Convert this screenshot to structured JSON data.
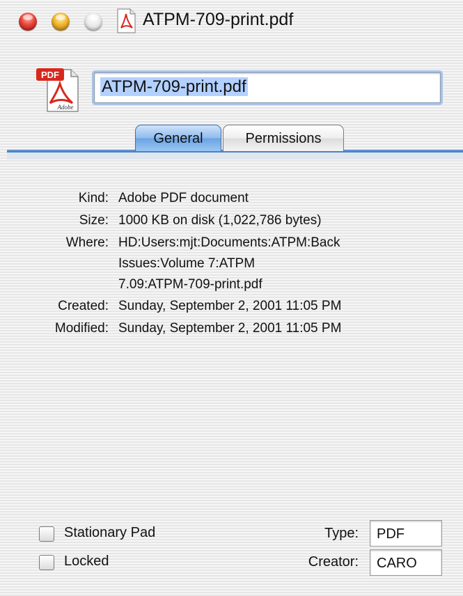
{
  "window": {
    "title": "ATPM-709-print.pdf"
  },
  "name_field": {
    "value": "ATPM-709-print.pdf"
  },
  "tabs": [
    {
      "label": "General",
      "selected": true
    },
    {
      "label": "Permissions",
      "selected": false
    }
  ],
  "info": {
    "kind_label": "Kind:",
    "kind_value": "Adobe PDF document",
    "size_label": "Size:",
    "size_value": "1000 KB on disk (1,022,786 bytes)",
    "where_label": "Where:",
    "where_line1": "HD:Users:mjt:Documents:ATPM:Back",
    "where_line2": "Issues:Volume 7:ATPM",
    "where_line3": "7.09:ATPM-709-print.pdf",
    "created_label": "Created:",
    "created_value": "Sunday, September 2, 2001 11:05  PM",
    "modified_label": "Modified:",
    "modified_value": "Sunday, September 2, 2001 11:05  PM"
  },
  "options": {
    "stationary_label": "Stationary Pad",
    "stationary_checked": false,
    "locked_label": "Locked",
    "locked_checked": false
  },
  "type_creator": {
    "type_label": "Type:",
    "type_value": "PDF",
    "creator_label": "Creator:",
    "creator_value": "CARO"
  },
  "icons": {
    "close": "close-button-icon",
    "minimize": "minimize-button-icon",
    "zoom": "zoom-button-icon",
    "document": "pdf-document-icon"
  },
  "colors": {
    "accent": "#3d78c3",
    "pdf_red": "#d8281e"
  },
  "icon_text": {
    "badge": "PDF",
    "brand": "Adobe"
  }
}
